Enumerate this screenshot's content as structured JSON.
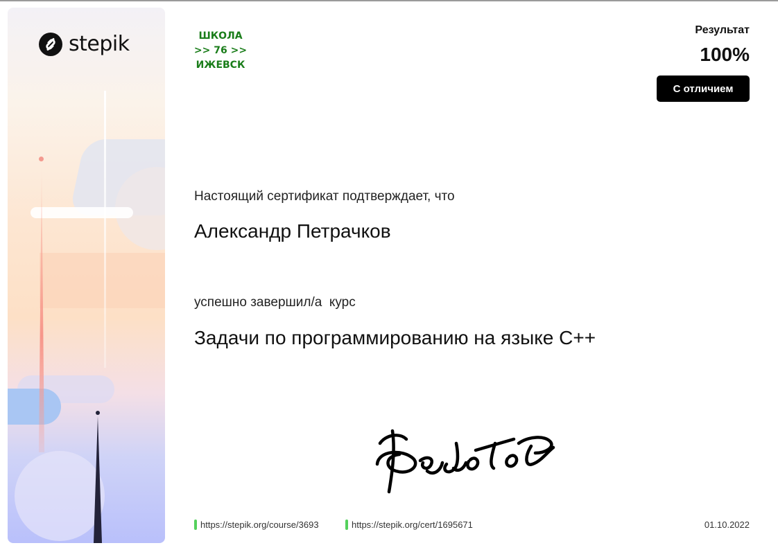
{
  "brand": {
    "logo_text": "stepik",
    "logo_icon": "stepik-logo-icon"
  },
  "school_stamp": {
    "line1": "ШКОЛА",
    "line2": ">> 76 >>",
    "line3": "ИЖЕВСК",
    "color": "#1a7d1a"
  },
  "result": {
    "label": "Результат",
    "value": "100%",
    "badge": "С отличием"
  },
  "certificate": {
    "confirm_text": "Настоящий сертификат подтверждает, что",
    "recipient": "Александр Петрачков",
    "completed_text": "успешно завершил/а  курс",
    "course_title": "Задачи по программированию на языке C++"
  },
  "signature": {
    "icon": "handwritten-signature"
  },
  "footer": {
    "course_link": "https://stepik.org/course/3693",
    "cert_link": "https://stepik.org/cert/1695671",
    "date": "01.10.2022",
    "accent_color": "#54d15c"
  }
}
